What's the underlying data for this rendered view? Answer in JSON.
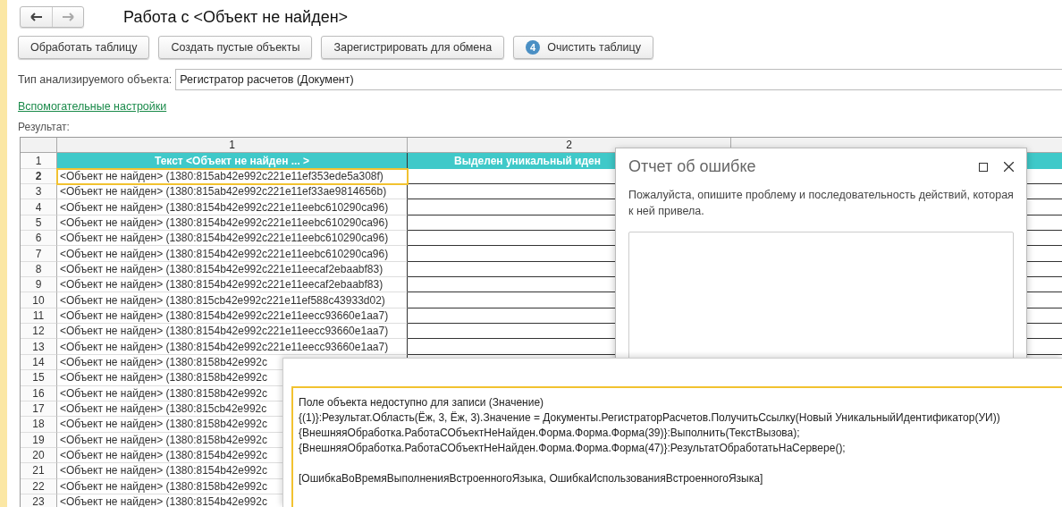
{
  "window": {
    "title": "Работа с <Объект не найден>"
  },
  "nav": {
    "back_disabled": false,
    "forward_disabled": true
  },
  "toolbar": [
    {
      "label": "Обработать таблицу"
    },
    {
      "label": "Создать пустые объекты"
    },
    {
      "label": "Зарегистрировать для обмена"
    },
    {
      "label": "Очистить таблицу",
      "badge": "4"
    }
  ],
  "object_type": {
    "label": "Тип анализируемого объекта:",
    "value": "Регистратор расчетов (Документ)"
  },
  "settings_link": "Вспомогательные настройки",
  "result_label": "Результат:",
  "table": {
    "columns": [
      "1",
      "2"
    ],
    "header_row": {
      "number": "1",
      "cells": [
        "Текст <Объект не найден ... >",
        "Выделен уникальный иден"
      ]
    },
    "rows": [
      {
        "number": "2",
        "text": "<Объект не найден> (1380:815ab42e992c221e11ef353ede5a308f)",
        "selected": true
      },
      {
        "number": "3",
        "text": "<Объект не найден> (1380:815ab42e992c221e11ef33ae9814656b)",
        "selected": false
      },
      {
        "number": "4",
        "text": "<Объект не найден> (1380:8154b42e992c221e11eebc610290ca96)",
        "selected": false
      },
      {
        "number": "5",
        "text": "<Объект не найден> (1380:8154b42e992c221e11eebc610290ca96)",
        "selected": false
      },
      {
        "number": "6",
        "text": "<Объект не найден> (1380:8154b42e992c221e11eebc610290ca96)",
        "selected": false
      },
      {
        "number": "7",
        "text": "<Объект не найден> (1380:8154b42e992c221e11eebc610290ca96)",
        "selected": false
      },
      {
        "number": "8",
        "text": "<Объект не найден> (1380:8154b42e992c221e11eecaf2ebaabf83)",
        "selected": false
      },
      {
        "number": "9",
        "text": "<Объект не найден> (1380:8154b42e992c221e11eecaf2ebaabf83)",
        "selected": false
      },
      {
        "number": "10",
        "text": "<Объект не найден> (1380:815cb42e992c221e11ef588c43933d02)",
        "selected": false
      },
      {
        "number": "11",
        "text": "<Объект не найден> (1380:8154b42e992c221e11eecc93660e1aa7)",
        "selected": false
      },
      {
        "number": "12",
        "text": "<Объект не найден> (1380:8154b42e992c221e11eecc93660e1aa7)",
        "selected": false
      },
      {
        "number": "13",
        "text": "<Объект не найден> (1380:8154b42e992c221e11eecc93660e1aa7)",
        "selected": false
      },
      {
        "number": "14",
        "text": "<Объект не найден> (1380:8158b42e992c",
        "selected": false
      },
      {
        "number": "15",
        "text": "<Объект не найден> (1380:8158b42e992c",
        "selected": false
      },
      {
        "number": "16",
        "text": "<Объект не найден> (1380:8158b42e992c",
        "selected": false
      },
      {
        "number": "17",
        "text": "<Объект не найден> (1380:815cb42e992c",
        "selected": false
      },
      {
        "number": "18",
        "text": "<Объект не найден> (1380:8158b42e992c",
        "selected": false
      },
      {
        "number": "19",
        "text": "<Объект не найден> (1380:8158b42e992c",
        "selected": false
      },
      {
        "number": "20",
        "text": "<Объект не найден> (1380:8154b42e992c",
        "selected": false
      },
      {
        "number": "21",
        "text": "<Объект не найден> (1380:8154b42e992c",
        "selected": false
      },
      {
        "number": "22",
        "text": "<Объект не найден> (1380:8158b42e992c",
        "selected": false
      },
      {
        "number": "23",
        "text": "<Объект не найден> (1380:8154b42e992c",
        "selected": false
      }
    ]
  },
  "error_dialog": {
    "title": "Отчет об ошибке",
    "description": "Пожалуйста, опишите проблему и последовательность действий, которая к ней привела."
  },
  "error_message": {
    "blocks": [
      [
        "Поле объекта недоступно для записи (Значение)",
        "{(1)}:Результат.Область(Ёж, 3, Ёж, 3).Значение = Документы.РегистраторРасчетов.ПолучитьСсылку(Новый УникальныйИдентификатор(УИ))",
        "{ВнешняяОбработка.РаботаСОбъектНеНайден.Форма.Форма.Форма(39)}:Выполнить(ТекстВызова);",
        "{ВнешняяОбработка.РаботаСОбъектНеНайден.Форма.Форма.Форма(47)}:РезультатОбработатьНаСервере();"
      ],
      [
        "[ОшибкаВоВремяВыполненияВстроенногоЯзыка, ОшибкаИспользованияВстроенногоЯзыка]"
      ]
    ]
  }
}
